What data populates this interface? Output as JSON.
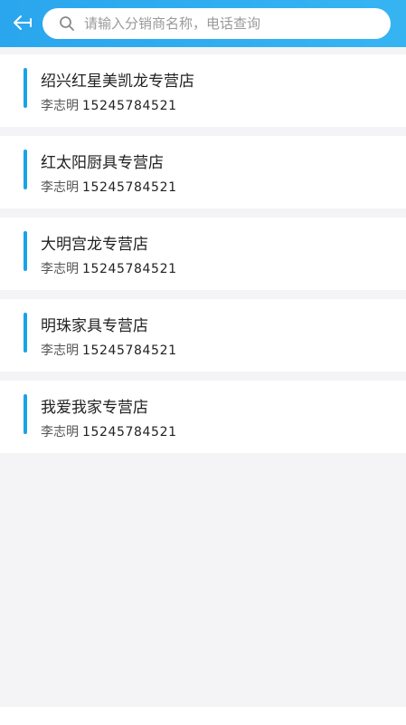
{
  "header": {
    "search_placeholder": "请输入分销商名称，电话查询"
  },
  "stores": [
    {
      "name": "绍兴红星美凯龙专营店",
      "contact": "李志明",
      "phone": "15245784521"
    },
    {
      "name": "红太阳厨具专营店",
      "contact": "李志明",
      "phone": "15245784521"
    },
    {
      "name": "大明宫龙专营店",
      "contact": "李志明",
      "phone": "15245784521"
    },
    {
      "name": "明珠家具专营店",
      "contact": "李志明",
      "phone": "15245784521"
    },
    {
      "name": "我爱我家专营店",
      "contact": "李志明",
      "phone": "15245784521"
    }
  ],
  "colors": {
    "header": "#2aa6ee",
    "accent": "#1aa3e8",
    "background": "#f4f4f6"
  }
}
